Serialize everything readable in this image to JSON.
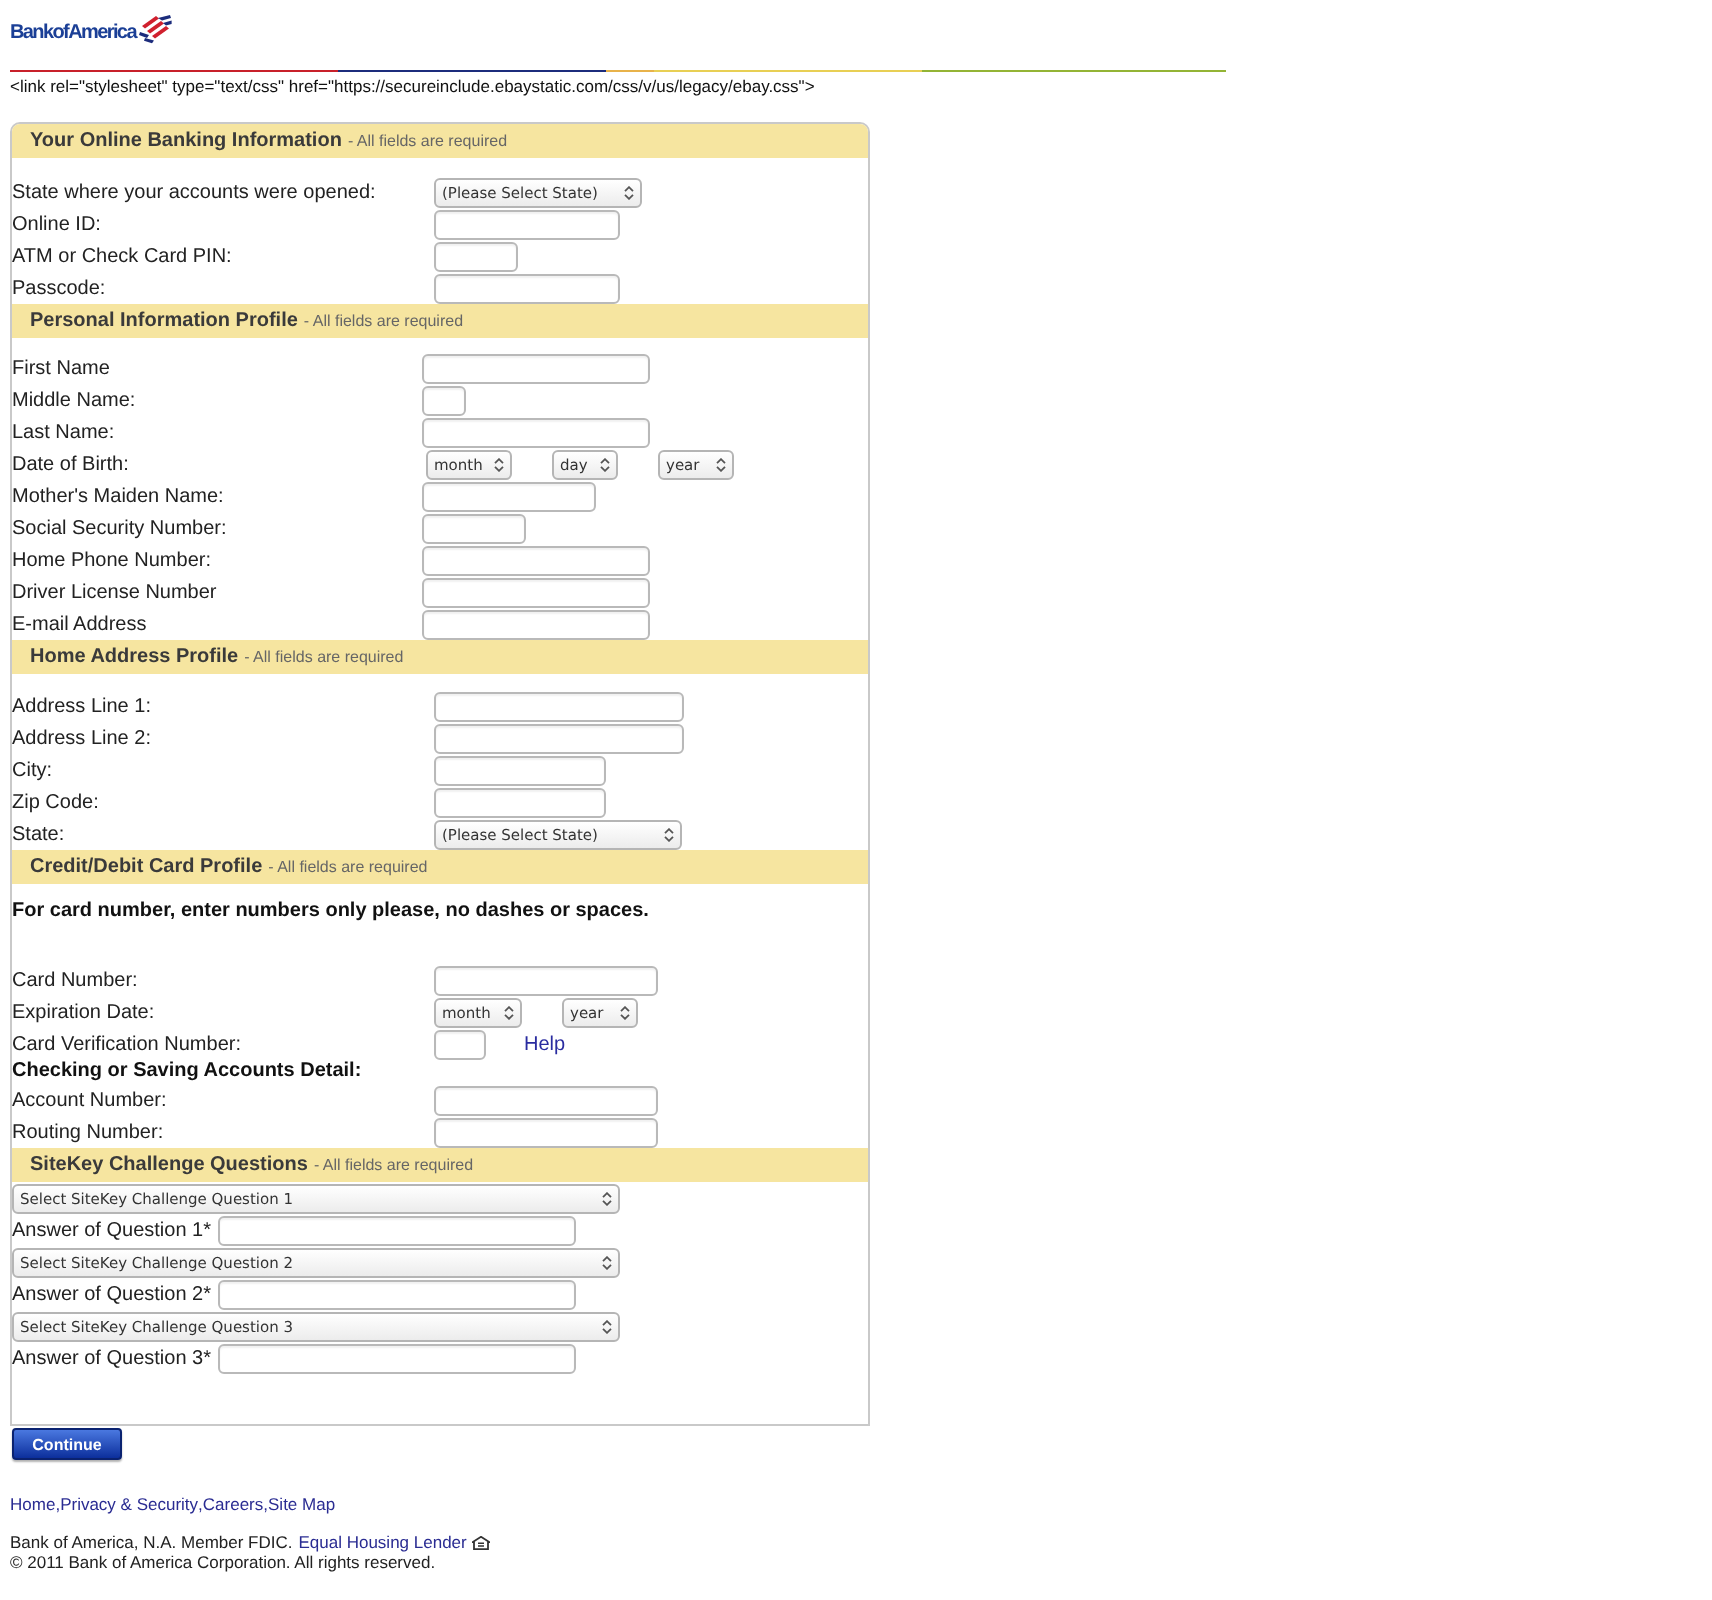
{
  "header": {
    "logo_text": "BankofAmerica",
    "stylesheet_text": "<link rel=\"stylesheet\" type=\"text/css\" href=\"https://secureinclude.ebaystatic.com/css/v/us/legacy/ebay.css\">"
  },
  "sections": [
    {
      "title": "Your Online Banking Information",
      "note": "- All fields are required",
      "rows": [
        {
          "kind": "select",
          "label": "State where your accounts were opened:",
          "selects": [
            "(Please Select State)"
          ]
        },
        {
          "kind": "input",
          "label": "Online ID:"
        },
        {
          "kind": "input",
          "label": "ATM or Check Card PIN:"
        },
        {
          "kind": "input",
          "label": "Passcode:"
        }
      ]
    },
    {
      "title": "Personal Information Profile",
      "note": "- All fields are required",
      "rows": [
        {
          "kind": "input",
          "label": "First Name"
        },
        {
          "kind": "input",
          "label": "Middle Name:"
        },
        {
          "kind": "input",
          "label": "Last Name:"
        },
        {
          "kind": "select",
          "label": "Date of Birth:",
          "selects": [
            "month",
            "day",
            "year"
          ]
        },
        {
          "kind": "input",
          "label": "Mother's Maiden Name:"
        },
        {
          "kind": "input",
          "label": "Social Security Number:"
        },
        {
          "kind": "input",
          "label": "Home Phone Number:"
        },
        {
          "kind": "input",
          "label": "Driver License Number"
        },
        {
          "kind": "input",
          "label": "E-mail Address"
        }
      ]
    },
    {
      "title": "Home Address Profile",
      "note": "- All fields are required",
      "rows": [
        {
          "kind": "input",
          "label": "Address Line 1:"
        },
        {
          "kind": "input",
          "label": "Address Line 2:"
        },
        {
          "kind": "input",
          "label": "City:"
        },
        {
          "kind": "input",
          "label": "Zip Code:"
        },
        {
          "kind": "select",
          "label": "State:",
          "selects": [
            "(Please Select State)"
          ]
        }
      ]
    },
    {
      "title": "Credit/Debit Card Profile",
      "note": "- All fields are required",
      "rows": [
        {
          "kind": "notice",
          "text": "For card number, enter numbers only please, no dashes or spaces."
        },
        {
          "kind": "input",
          "label": "Card Number:"
        },
        {
          "kind": "select",
          "label": "Expiration Date:",
          "selects": [
            "month",
            "year"
          ]
        },
        {
          "kind": "input",
          "label": "Card Verification Number:",
          "link": "Help"
        },
        {
          "kind": "heading",
          "text": "Checking or Saving Accounts Detail:"
        },
        {
          "kind": "input",
          "label": "Account Number:"
        },
        {
          "kind": "input",
          "label": "Routing Number:"
        }
      ]
    },
    {
      "title": "SiteKey Challenge Questions",
      "note": "- All fields are required",
      "rows": [
        {
          "kind": "question",
          "selects": [
            "Select SiteKey Challenge Question 1"
          ]
        },
        {
          "kind": "answer",
          "label": "Answer of Question 1*"
        },
        {
          "kind": "question",
          "selects": [
            "Select SiteKey Challenge Question 2"
          ]
        },
        {
          "kind": "answer",
          "label": "Answer of Question 2*"
        },
        {
          "kind": "question",
          "selects": [
            "Select SiteKey Challenge Question 3"
          ]
        },
        {
          "kind": "answer",
          "label": "Answer of Question 3*"
        }
      ]
    }
  ],
  "submit_button": "Continue",
  "footer": {
    "links": [
      "Home",
      "Privacy & Security",
      "Careers",
      "Site Map"
    ],
    "separator": ",",
    "legal_text": "Bank of America, N.A. Member FDIC.",
    "legal_link": "Equal Housing Lender",
    "copyright": "© 2011 Bank of America Corporation. All rights reserved."
  }
}
